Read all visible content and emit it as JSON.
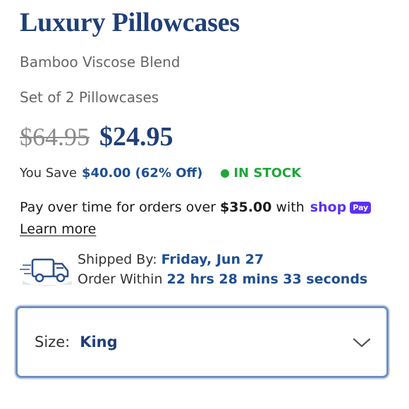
{
  "product": {
    "title": "Luxury Pillowcases",
    "material": "Bamboo Viscose Blend",
    "set_info": "Set of 2 Pillowcases"
  },
  "pricing": {
    "original_price": "$64.95",
    "sale_price": "$24.95",
    "save_label": "You Save",
    "save_amount": "$40.00 (62% Off)"
  },
  "stock": {
    "status": "IN STOCK",
    "color": "#1fa63a"
  },
  "payment": {
    "text_before": "Pay over time for orders over",
    "threshold": "$35.00",
    "text_after": "with",
    "shop_word": "shop",
    "badge": "Pay",
    "learn_more": "Learn more",
    "brand_color": "#5a31f4"
  },
  "shipping": {
    "icon": "delivery-truck-icon",
    "shipped_by_label": "Shipped By:",
    "shipped_by_value": "Friday, Jun 27",
    "order_within_label": "Order Within",
    "order_within_value": "22 hrs 28 mins 33 seconds"
  },
  "size_select": {
    "label": "Size:",
    "value": "King",
    "icon": "chevron-down-icon"
  },
  "colors": {
    "title": "#1f3f78",
    "accent": "#1f4f8f"
  }
}
